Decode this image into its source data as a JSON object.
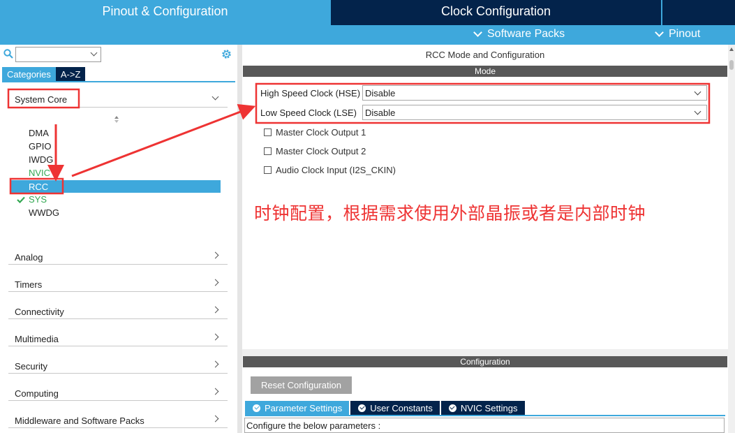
{
  "top_tabs": {
    "pinout_config": "Pinout & Configuration",
    "clock_config": "Clock Configuration"
  },
  "sub_menu": {
    "software_packs": "Software Packs",
    "pinout": "Pinout"
  },
  "left_panel": {
    "search_value": "",
    "tabs": {
      "categories": "Categories",
      "az": "A->Z"
    },
    "system_core": {
      "label": "System Core",
      "peripherals": [
        "DMA",
        "GPIO",
        "IWDG",
        "NVIC",
        "RCC",
        "SYS",
        "WWDG"
      ],
      "selected": "RCC",
      "checked": "SYS"
    },
    "categories": [
      "Analog",
      "Timers",
      "Connectivity",
      "Multimedia",
      "Security",
      "Computing",
      "Middleware and Software Packs"
    ]
  },
  "right_panel": {
    "title": "RCC Mode and Configuration",
    "mode_header": "Mode",
    "hse": {
      "label": "High Speed Clock (HSE)",
      "value": "Disable"
    },
    "lse": {
      "label": "Low Speed Clock (LSE)",
      "value": "Disable"
    },
    "checkboxes": [
      "Master Clock Output 1",
      "Master Clock Output 2",
      "Audio Clock Input (I2S_CKIN)"
    ],
    "annotation": "时钟配置，根据需求使用外部晶振或者是内部时钟",
    "config_header": "Configuration",
    "reset_button": "Reset Configuration",
    "config_tabs": [
      "Parameter Settings",
      "User Constants",
      "NVIC Settings"
    ],
    "config_text": "Configure the below parameters :"
  },
  "colors": {
    "accent_blue": "#3ea8dc",
    "dark_navy": "#03234b",
    "header_gray": "#585858",
    "annotation_red": "#ee3333",
    "green": "#34a853"
  }
}
